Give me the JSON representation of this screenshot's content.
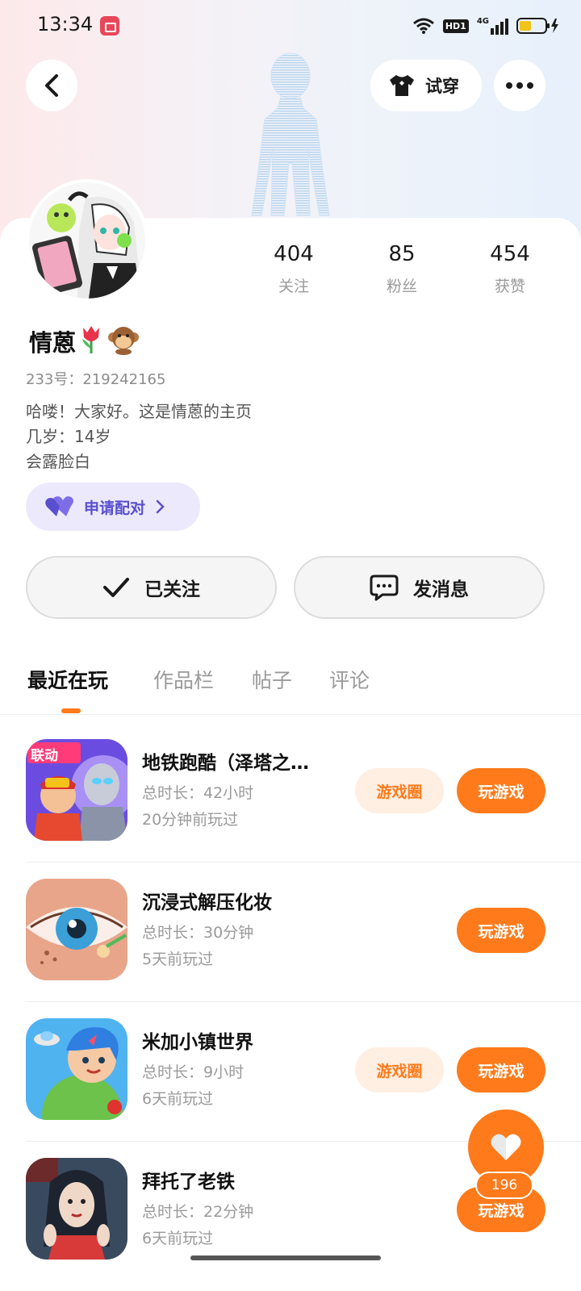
{
  "status_bar": {
    "time": "13:34",
    "network": "4G",
    "hd_badge": "HD1"
  },
  "header": {
    "try_on_label": "试穿",
    "back_icon": "chevron-left-icon",
    "more_icon": "more-dots-icon",
    "try_on_icon": "tshirt-icon"
  },
  "profile": {
    "stats": [
      {
        "value": "404",
        "label": "关注"
      },
      {
        "value": "85",
        "label": "粉丝"
      },
      {
        "value": "454",
        "label": "获赞"
      }
    ],
    "nickname": "情蒽",
    "emojis": [
      "tulip-emoji",
      "monkey-emoji"
    ],
    "user_id": "233号：219242165",
    "bio": [
      "哈喽！大家好。这是情蒽的主页",
      "几岁：14岁",
      "会露脸白"
    ],
    "pair_button": "申请配对"
  },
  "actions": {
    "followed": "已关注",
    "message": "发消息"
  },
  "tabs": [
    {
      "label": "最近在玩",
      "active": true
    },
    {
      "label": "作品栏",
      "active": false
    },
    {
      "label": "帖子",
      "active": false
    },
    {
      "label": "评论",
      "active": false
    }
  ],
  "games": [
    {
      "title": "地铁跑酷（泽塔之…",
      "meta1": "总时长：42小时",
      "meta2": "20分钟前玩过",
      "has_circle": true,
      "circle_label": "游戏圈",
      "play_label": "玩游戏",
      "badge": "联动"
    },
    {
      "title": "沉浸式解压化妆",
      "meta1": "总时长：30分钟",
      "meta2": "5天前玩过",
      "has_circle": false,
      "play_label": "玩游戏"
    },
    {
      "title": "米加小镇世界",
      "meta1": "总时长：9小时",
      "meta2": "6天前玩过",
      "has_circle": true,
      "circle_label": "游戏圈",
      "play_label": "玩游戏"
    },
    {
      "title": "拜托了老铁",
      "meta1": "总时长：22分钟",
      "meta2": "6天前玩过",
      "has_circle": false,
      "play_label": "玩游戏"
    }
  ],
  "like_fab": {
    "count": "196"
  },
  "colors": {
    "accent": "#ff7a1a",
    "pair_bg": "#ece9fc",
    "pair_text": "#5a4fcf"
  }
}
